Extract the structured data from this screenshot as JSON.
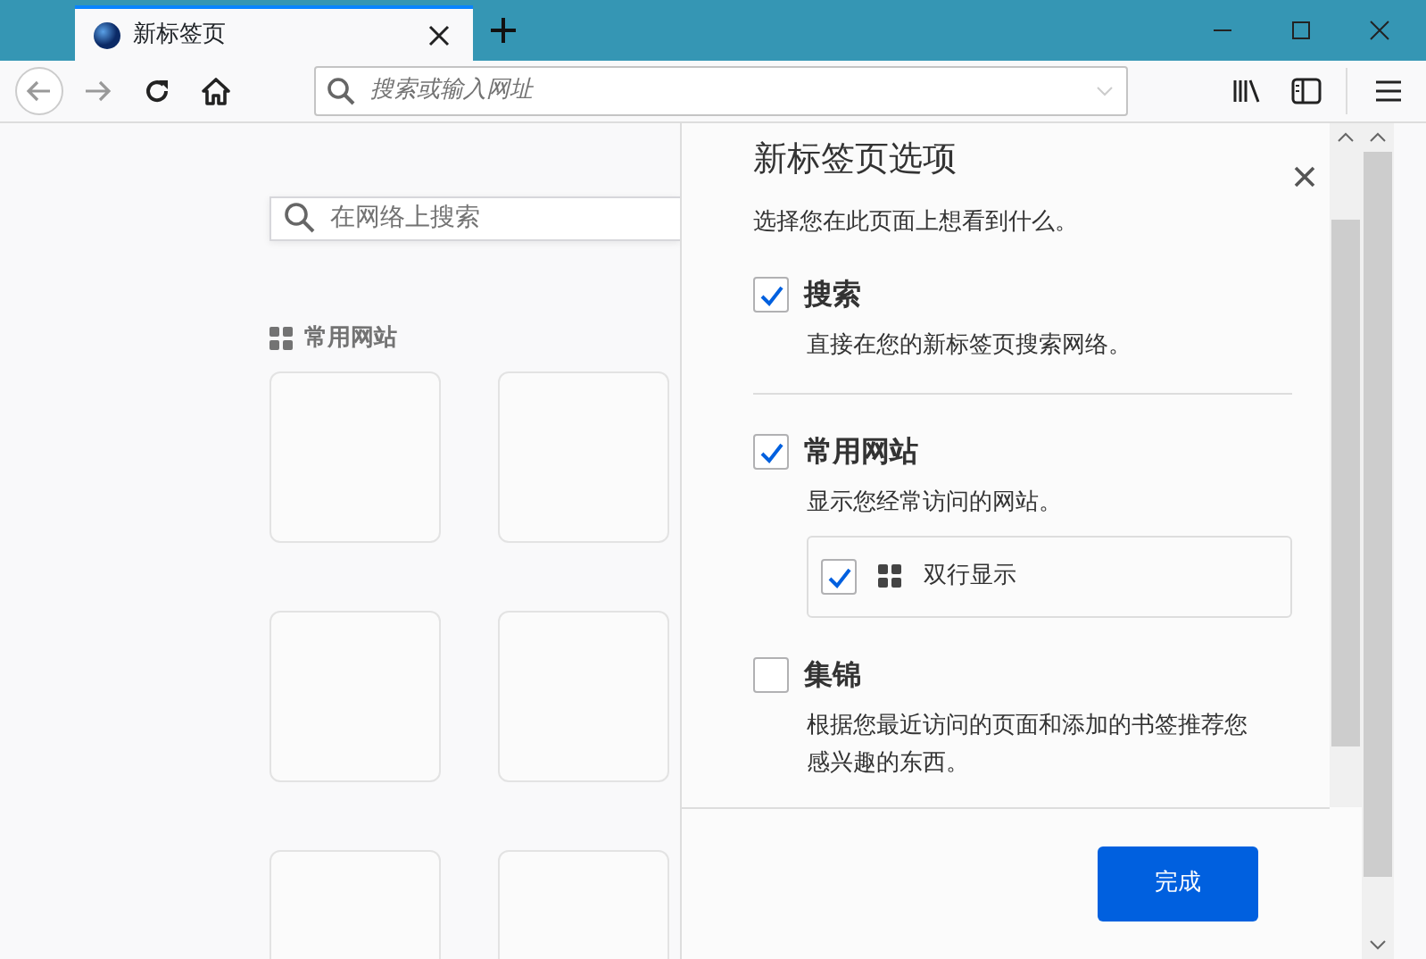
{
  "window": {
    "tab": {
      "title": "新标签页",
      "selected": true
    }
  },
  "toolbar": {
    "address_placeholder": "搜索或输入网址"
  },
  "page": {
    "search_placeholder": "在网络上搜索",
    "top_sites_heading": "常用网站"
  },
  "panel": {
    "title": "新标签页选项",
    "subtitle": "选择您在此页面上想看到什么。",
    "sections": [
      {
        "label": "搜索",
        "description": "直接在您的新标签页搜索网络。",
        "checked": true
      },
      {
        "label": "常用网站",
        "description": "显示您经常访问的网站。",
        "checked": true,
        "option": {
          "label": "双行显示",
          "checked": true
        }
      },
      {
        "label": "集锦",
        "description": "根据您最近访问的页面和添加的书签推荐您感兴趣的东西。",
        "checked": false
      }
    ],
    "done_button": "完成"
  }
}
